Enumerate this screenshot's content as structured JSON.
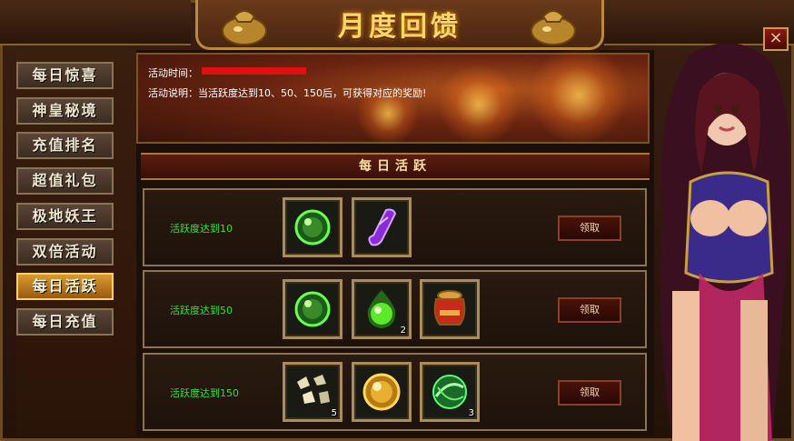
{
  "window": {
    "title": "月度回馈",
    "close_icon": "×"
  },
  "sidebar": {
    "items": [
      {
        "label": "每日惊喜",
        "active": false
      },
      {
        "label": "神皇秘境",
        "active": false
      },
      {
        "label": "充值排名",
        "active": false
      },
      {
        "label": "超值礼包",
        "active": false
      },
      {
        "label": "极地妖王",
        "active": false
      },
      {
        "label": "双倍活动",
        "active": false
      },
      {
        "label": "每日活跃",
        "active": true
      },
      {
        "label": "每日充值",
        "active": false
      }
    ]
  },
  "activity": {
    "time_label": "活动时间：",
    "description": "活动说明：当活跃度达到10、50、150后，可获得对应的奖励!"
  },
  "section": {
    "title": "每日活跃"
  },
  "rows": [
    {
      "label": "活跃度达到10",
      "button": "领取",
      "items": [
        {
          "icon": "green-orb-icon",
          "count": ""
        },
        {
          "icon": "purple-scroll-icon",
          "count": ""
        }
      ]
    },
    {
      "label": "活跃度达到50",
      "button": "领取",
      "items": [
        {
          "icon": "green-orb-icon",
          "count": ""
        },
        {
          "icon": "green-flame-orb-icon",
          "count": "2"
        },
        {
          "icon": "red-jar-icon",
          "count": ""
        }
      ]
    },
    {
      "label": "活跃度达到150",
      "button": "领取",
      "items": [
        {
          "icon": "stone-shards-icon",
          "count": "5"
        },
        {
          "icon": "gold-orb-icon",
          "count": ""
        },
        {
          "icon": "green-swirl-orb-icon",
          "count": "3"
        }
      ]
    }
  ],
  "colors": {
    "accent_gold": "#ffd86a",
    "active_tab": "#d89a30",
    "row_label_green": "#30e030",
    "redaction_red": "#e01010"
  }
}
